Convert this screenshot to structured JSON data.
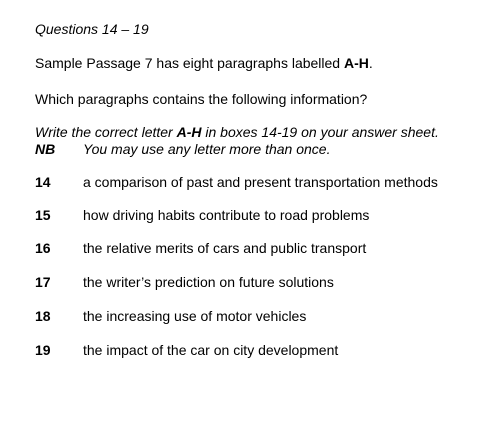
{
  "heading": "Questions 14 – 19",
  "intro": {
    "prefix": "Sample Passage 7 has eight paragraphs labelled ",
    "range": "A-H",
    "suffix": "."
  },
  "question_prompt": "Which paragraphs contains the following information?",
  "instruction": {
    "prefix": "Write the correct letter ",
    "range": "A-H",
    "suffix": " in boxes 14-19 on your answer sheet."
  },
  "note": {
    "label": "NB",
    "text": "You may use any letter more than once."
  },
  "questions": [
    {
      "number": "14",
      "text": "a comparison of past and present transportation methods"
    },
    {
      "number": "15",
      "text": "how driving habits contribute to road problems"
    },
    {
      "number": "16",
      "text": "the relative merits of cars and public transport"
    },
    {
      "number": "17",
      "text": "the writer’s prediction on future solutions"
    },
    {
      "number": "18",
      "text": "the increasing use of motor vehicles"
    },
    {
      "number": "19",
      "text": "the impact of the car on city development"
    }
  ]
}
